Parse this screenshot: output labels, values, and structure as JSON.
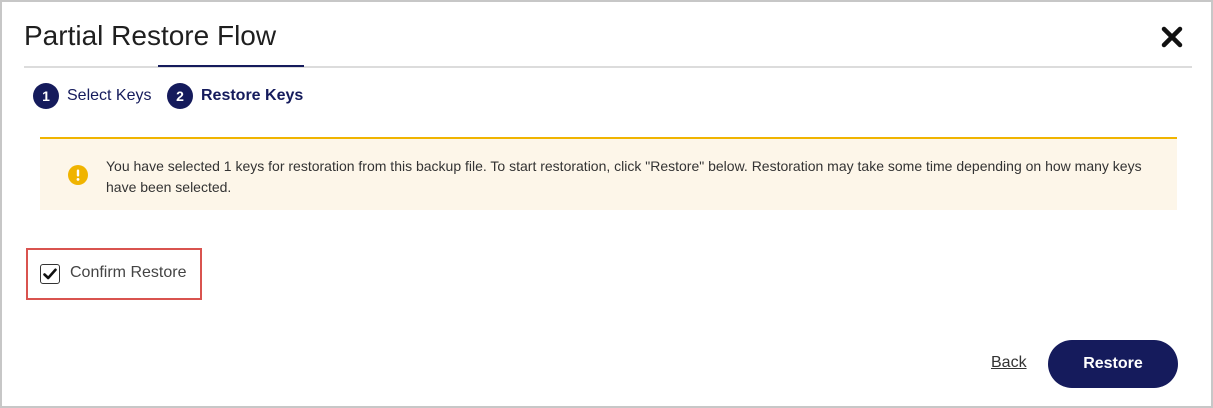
{
  "dialog": {
    "title": "Partial Restore Flow",
    "close_icon": "close-icon"
  },
  "steps": [
    {
      "number": "1",
      "label": "Select Keys",
      "active": false
    },
    {
      "number": "2",
      "label": "Restore Keys",
      "active": true
    }
  ],
  "alert": {
    "icon": "warning-icon",
    "message": "You have selected 1 keys for restoration from this backup file. To start restoration, click \"Restore\" below. Restoration may take some time depending on how many keys have been selected."
  },
  "confirm": {
    "label": "Confirm Restore",
    "checked": true
  },
  "footer": {
    "back_label": "Back",
    "restore_label": "Restore"
  },
  "colors": {
    "primary": "#151b5c",
    "alert_border": "#f0b400",
    "alert_background": "#fdf6e9",
    "highlight_border": "#d9534f"
  }
}
